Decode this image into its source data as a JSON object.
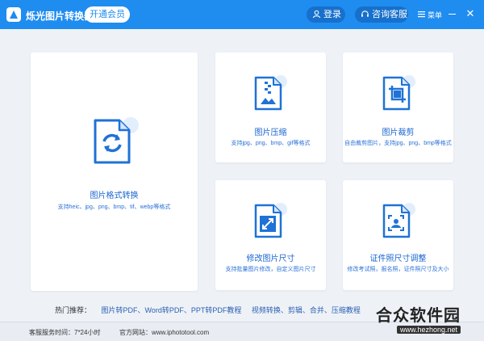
{
  "app": {
    "title": "烁光图片转换器",
    "vip_label": "开通会员"
  },
  "header": {
    "login_label": "登录",
    "support_label": "咨询客服",
    "menu_label": "菜单"
  },
  "cards": {
    "format": {
      "title": "图片格式转换",
      "desc": "支持heic、jpg、png、bmp、tif、webp等格式"
    },
    "compress": {
      "title": "图片压缩",
      "desc": "支持jpg、png、bmp、gif等格式"
    },
    "crop": {
      "title": "图片裁剪",
      "desc": "自由裁剪图片，支持jpg、png、bmp等格式"
    },
    "resize": {
      "title": "修改图片尺寸",
      "desc": "支持批量图片修改，自定义图片尺寸"
    },
    "idphoto": {
      "title": "证件照尺寸调整",
      "desc": "修改考试照，报名照，证件照尺寸及大小"
    }
  },
  "hot": {
    "label": "热门推荐：",
    "links": [
      "图片转PDF、Word转PDF、PPT转PDF教程",
      "视频转换、剪辑、合并、压缩教程"
    ]
  },
  "footer": {
    "hours": "客服服务时间：7*24小时",
    "site": "官方网站：www.iphototool.com"
  },
  "watermark": {
    "text": "合众软件园",
    "sub": "www.hezhong.net"
  },
  "colors": {
    "brand": "#1f8cf0",
    "accent_text": "#1a66d0"
  }
}
